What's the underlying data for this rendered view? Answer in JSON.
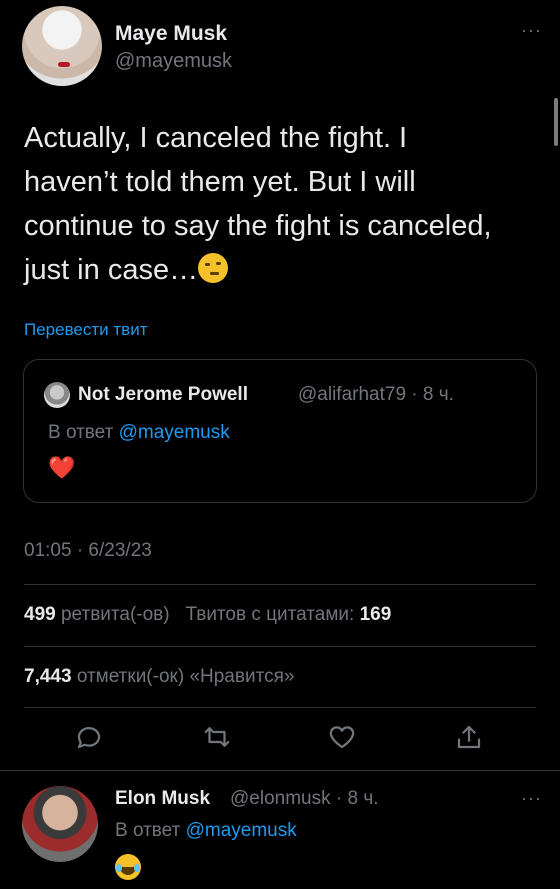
{
  "tweet": {
    "author_name": "Maye Musk",
    "author_handle": "@mayemusk",
    "text": "Actually, I canceled the fight. I haven’t told them yet. But I will continue to say the fight is canceled, just in case…",
    "emoji": "raised-eyebrow-face-icon",
    "translate_label": "Перевести твит",
    "timestamp": "01:05 · 6/23/23",
    "retweets_count": "499",
    "retweets_label": "ретвита(-ов)",
    "quotes_label": "Твитов с цитатами:",
    "quotes_count": "169",
    "likes_count": "7,443",
    "likes_label": "отметки(-ок) «Нравится»",
    "more_label": "···"
  },
  "quoted": {
    "author_name": "Not Jerome Powell",
    "meta": "@alifarhat79 · 8 ч.",
    "reply_prefix": "В ответ",
    "reply_mention": "@mayemusk",
    "emoji": "❤️"
  },
  "actions": [
    {
      "name": "reply-icon"
    },
    {
      "name": "retweet-icon"
    },
    {
      "name": "like-icon"
    },
    {
      "name": "share-icon"
    }
  ],
  "reply": {
    "author_name": "Elon Musk",
    "meta": "@elonmusk · 8 ч.",
    "reply_prefix": "В ответ",
    "reply_mention": "@mayemusk",
    "emoji": "tears-of-joy-face-icon",
    "more_label": "···"
  },
  "colors": {
    "background": "#000000",
    "text": "#e7e9ea",
    "muted": "#71767b",
    "link": "#1d9bf0",
    "divider": "#2f3336"
  }
}
